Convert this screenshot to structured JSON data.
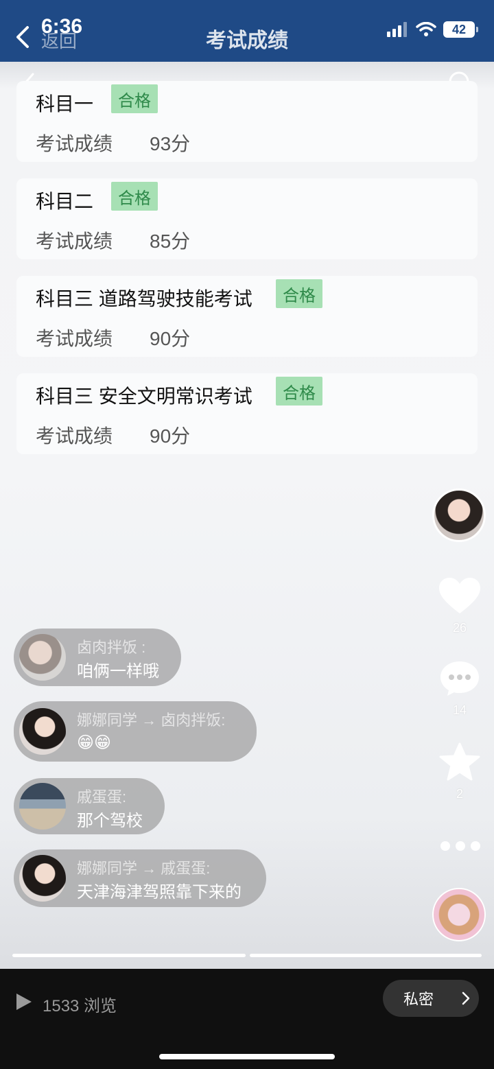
{
  "status_bar": {
    "time": "6:36",
    "battery": "42"
  },
  "header": {
    "back_label": "返回",
    "title": "考试成绩"
  },
  "results": [
    {
      "subject": "科目一",
      "badge": "合格",
      "score_label": "考试成绩",
      "score": "93分"
    },
    {
      "subject": "科目二",
      "badge": "合格",
      "score_label": "考试成绩",
      "score": "85分"
    },
    {
      "subject": "科目三 道路驾驶技能考试",
      "badge": "合格",
      "score_label": "考试成绩",
      "score": "90分"
    },
    {
      "subject": "科目三 安全文明常识考试",
      "badge": "合格",
      "score_label": "考试成绩",
      "score": "90分"
    }
  ],
  "actions": {
    "likes": "26",
    "comments": "14",
    "favorites": "2"
  },
  "comments": [
    {
      "user": "卤肉拌饭 :",
      "text": "咱俩一样哦"
    },
    {
      "user": "娜娜同学 → 卤肉拌饭:",
      "text": "😁😁"
    },
    {
      "user": "戚蛋蛋:",
      "text": "那个驾校"
    },
    {
      "user": "娜娜同学 → 戚蛋蛋:",
      "text": "天津海津驾照靠下来的"
    }
  ],
  "bottom": {
    "views": "1533 浏览",
    "private_label": "私密"
  },
  "colors": {
    "header": "#1f4a86",
    "pass_badge_bg": "#a7e0b4",
    "pass_badge_text": "#2f8a4a"
  }
}
